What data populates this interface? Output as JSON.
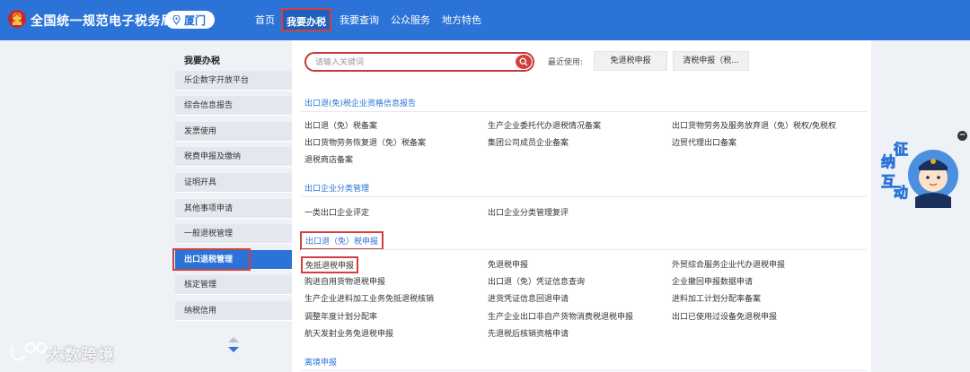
{
  "header": {
    "site_title": "全国统一规范电子税务局",
    "city": "厦门",
    "nav": [
      {
        "label": "首页"
      },
      {
        "label": "我要办税"
      },
      {
        "label": "我要查询"
      },
      {
        "label": "公众服务"
      },
      {
        "label": "地方特色"
      }
    ]
  },
  "sidebar": {
    "title": "我要办税",
    "items": [
      {
        "label": "乐企数字开放平台"
      },
      {
        "label": "综合信息报告"
      },
      {
        "label": "发票使用"
      },
      {
        "label": "税费申报及缴纳"
      },
      {
        "label": "证明开具"
      },
      {
        "label": "其他事项申请"
      },
      {
        "label": "一般退税管理"
      },
      {
        "label": "出口退税管理"
      },
      {
        "label": "核定管理"
      },
      {
        "label": "纳税信用"
      }
    ]
  },
  "search": {
    "placeholder": "请输入关键词",
    "recent_label": "最近使用:",
    "recent": [
      "免退税申报",
      "清税申报（税..."
    ]
  },
  "sections": [
    {
      "title": "出口退(免)税企业资格信息报告",
      "links": [
        "出口退（免）税备案",
        "生产企业委托代办退税情况备案",
        "出口货物劳务及服务放弃退（免）税权/免税权",
        "出口货物劳务恢复退（免）税备案",
        "集团公司成员企业备案",
        "边贸代理出口备案",
        "退税商店备案"
      ]
    },
    {
      "title": "出口企业分类管理",
      "links": [
        "一类出口企业评定",
        "出口企业分类管理复评"
      ]
    },
    {
      "title": "出口退（免）税申报",
      "links": [
        "免抵退税申报",
        "免退税申报",
        "外贸综合服务企业代办退税申报",
        "购进自用货物退税申报",
        "出口退（免）凭证信息查询",
        "企业撤回申报数据申请",
        "生产企业进料加工业务免抵退税核销",
        "进货凭证信息回退申请",
        "进料加工计划分配率备案",
        "调整年度计划分配率",
        "生产企业出口非自产货物消费税退税申报",
        "出口已使用过设备免退税申报",
        "航天发射业务免退税申报",
        "先退税后核销资格申请"
      ]
    },
    {
      "title": "离境申报"
    }
  ],
  "float_panel": {
    "chars": [
      "征",
      "纳",
      "互",
      "动"
    ]
  },
  "watermark": {
    "text": "大数跨境"
  },
  "colors": {
    "primary": "#2b73d6",
    "highlight_red": "#d2403d",
    "sidebar_bg": "#e3e8ef",
    "page_bg": "#eef1f6"
  }
}
